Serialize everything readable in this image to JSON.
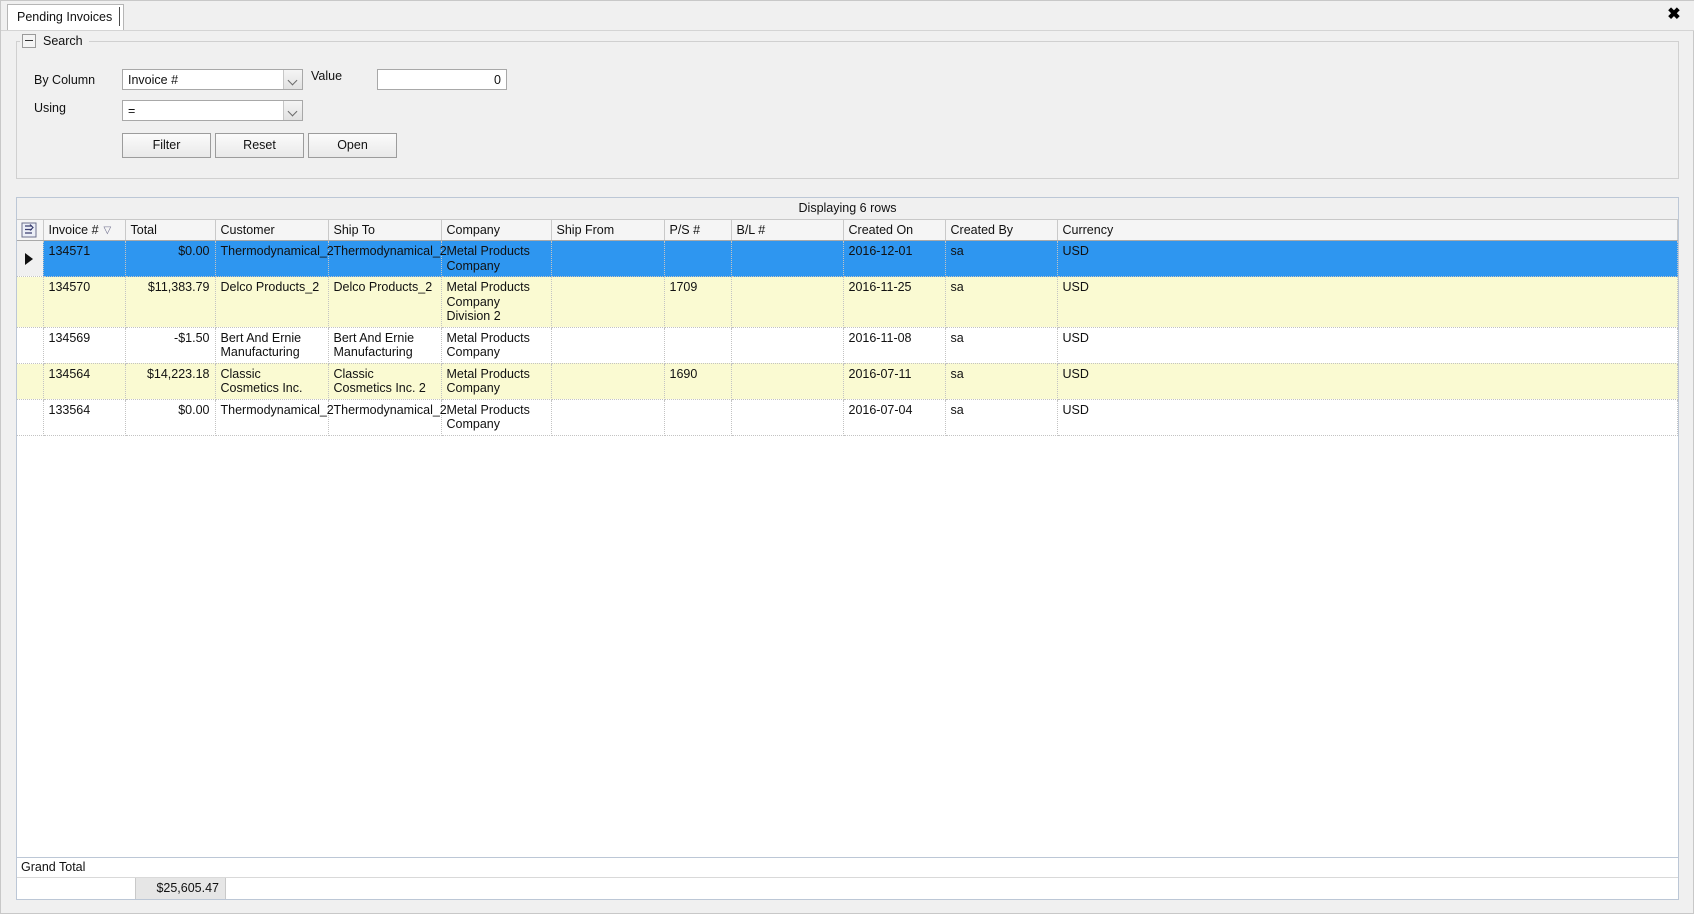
{
  "window": {
    "close_label": "✖"
  },
  "tabs": [
    {
      "label": "Pending Invoices"
    }
  ],
  "search": {
    "legend": "Search",
    "collapse_icon": "minus-icon",
    "by_column_label": "By Column",
    "by_column_value": "Invoice #",
    "using_label": "Using",
    "using_value": "=",
    "value_label": "Value",
    "value_current": "0",
    "buttons": {
      "filter": "Filter",
      "reset": "Reset",
      "open": "Open"
    }
  },
  "grid": {
    "caption": "Displaying 6 rows",
    "sort_column": "Invoice #",
    "sort_indicator": "▽",
    "corner_icon": "grid-select-all-icon",
    "columns": [
      "Invoice #",
      "Total",
      "Customer",
      "Ship To",
      "Company",
      "Ship From",
      "P/S #",
      "B/L #",
      "Created On",
      "Created By",
      "Currency"
    ],
    "rows": [
      {
        "invoice": "134571",
        "total": "$0.00",
        "customer": "Thermodynamical_2",
        "ship_to": "Thermodynamical_2",
        "company": "Metal Products Company",
        "ship_from": "",
        "ps_num": "",
        "bl_num": "",
        "created_on": "2016-12-01",
        "created_by": "sa",
        "currency": "USD",
        "state": "selected"
      },
      {
        "invoice": "134570",
        "total": "$11,383.79",
        "customer": "Delco Products_2",
        "ship_to": "Delco Products_2",
        "company": "Metal Products Company Division 2",
        "ship_from": "",
        "ps_num": "1709",
        "bl_num": "",
        "created_on": "2016-11-25",
        "created_by": "sa",
        "currency": "USD",
        "state": "alt"
      },
      {
        "invoice": "134569",
        "total": "-$1.50",
        "customer": "Bert And Ernie Manufacturing",
        "ship_to": "Bert And Ernie Manufacturing",
        "company": "Metal Products Company",
        "ship_from": "",
        "ps_num": "",
        "bl_num": "",
        "created_on": "2016-11-08",
        "created_by": "sa",
        "currency": "USD",
        "state": "normal"
      },
      {
        "invoice": "134564",
        "total": "$14,223.18",
        "customer": "Classic Cosmetics Inc.",
        "ship_to": "Classic Cosmetics Inc. 2",
        "company": "Metal Products Company",
        "ship_from": "",
        "ps_num": "1690",
        "bl_num": "",
        "created_on": "2016-07-11",
        "created_by": "sa",
        "currency": "USD",
        "state": "alt"
      },
      {
        "invoice": "133564",
        "total": "$0.00",
        "customer": "Thermodynamical_2",
        "ship_to": "Thermodynamical_2",
        "company": "Metal Products Company",
        "ship_from": "",
        "ps_num": "",
        "bl_num": "",
        "created_on": "2016-07-04",
        "created_by": "sa",
        "currency": "USD",
        "state": "normal"
      }
    ],
    "grand_total": {
      "label": "Grand Total",
      "value": "$25,605.47"
    }
  },
  "colors": {
    "selection": "#2e96f0",
    "alt_row": "#fafad2",
    "window_bg": "#f0f0f0"
  }
}
